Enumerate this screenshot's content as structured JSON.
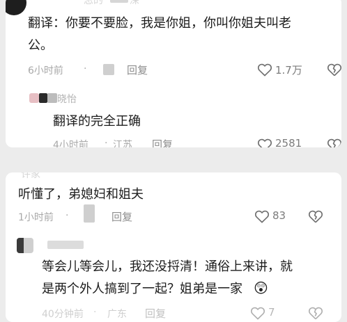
{
  "comment_top": {
    "username": "忌的",
    "username_suffix": "深",
    "text": "翻译：你要不要脸，我是你姐，你叫你姐夫叫老公。",
    "text_line1": "翻译：你要不要脸，我是你姐，你叫你姐夫叫老",
    "text_line2": "公。",
    "time": "6小时前",
    "dot": "·",
    "reply": "回复",
    "likes": "1.7万",
    "reply_item": {
      "username": "晓怡",
      "text": "翻译的完全正确",
      "time": "4小时前",
      "dot": "·",
      "location": "江苏",
      "reply": "回复",
      "likes": "2581"
    }
  },
  "comment_bottom": {
    "username": "许家",
    "text": "听懂了，弟媳妇和姐夫",
    "time": "1小时前",
    "dot": "·",
    "reply": "回复",
    "likes": "83",
    "reply_item": {
      "text_line1": "等会儿等会儿，我还没捋清！通俗上来讲，就",
      "text_line2": "是两个外人搞到了一起？姐弟是一家",
      "emoji": "😲",
      "time": "40分钟前",
      "dot": "·",
      "location": "广东",
      "reply": "回复",
      "likes": "7"
    }
  },
  "colors": {
    "background": "#ececec",
    "card": "#ffffff",
    "meta_gray": "#a8a8a8",
    "icon_gray": "#6f6f6f"
  },
  "icons": [
    "heart-outline-icon",
    "broken-heart-outline-icon"
  ]
}
